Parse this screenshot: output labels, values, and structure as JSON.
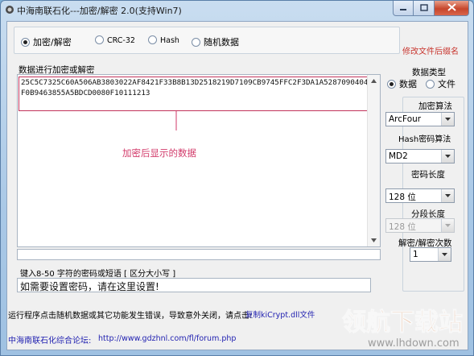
{
  "window": {
    "title": "中海南联石化---加密/解密 2.0(支持Win7)"
  },
  "mode": {
    "options": [
      "加密/解密",
      "CRC-32",
      "Hash",
      "随机数据"
    ],
    "selected": "加密/解密"
  },
  "rename_link": "修改文件后缀名",
  "data_panel": {
    "label": "数据进行加密或解密",
    "content": "25C5C7325C60A506AB3803022AF8421F33B8B13D2518219D7109CB9745FFC2F3DA1A52870904042F0B9463855A5BDCD0080F10111213",
    "annotation": "加密后显示的数据"
  },
  "data_type": {
    "label": "数据类型",
    "options": [
      "数据",
      "文件"
    ],
    "selected": "数据"
  },
  "settings": {
    "algorithm_label": "加密算法",
    "algorithm_value": "ArcFour",
    "hash_label": "Hash密码算法",
    "hash_value": "MD2",
    "key_length_label": "密码长度",
    "key_length_value": "128 位",
    "segment_length_label": "分段长度",
    "segment_length_value": "128 位",
    "rounds_label": "解密/解密次数",
    "rounds_value": "1"
  },
  "password": {
    "label": "键入8-50 字符的密码或短语 [ 区分大小写 ]",
    "value": "如需要设置密码，请在这里设置!"
  },
  "footer": {
    "error_note": "运行程序点击随机数据或其它功能发生错误，导致意外关闭，请点击:",
    "copy_link": "复制kiCrypt.dll文件",
    "forum_label": "中海南联石化综合论坛:",
    "forum_url": "http://www.gdzhnl.com/fl/forum.php"
  },
  "watermark": {
    "text": "领航下载站",
    "url": "www.lhdown.com"
  },
  "icons": [
    "app-icon",
    "minimize-icon",
    "maximize-icon",
    "close-icon",
    "scroll-up-icon",
    "scroll-down-icon",
    "dropdown-arrow-icon"
  ],
  "colors": {
    "accent_red": "#c8352e",
    "annotation_pink": "#d23a6a",
    "link_blue": "#1f1fb0",
    "titlebar": "#a9c8e6"
  }
}
